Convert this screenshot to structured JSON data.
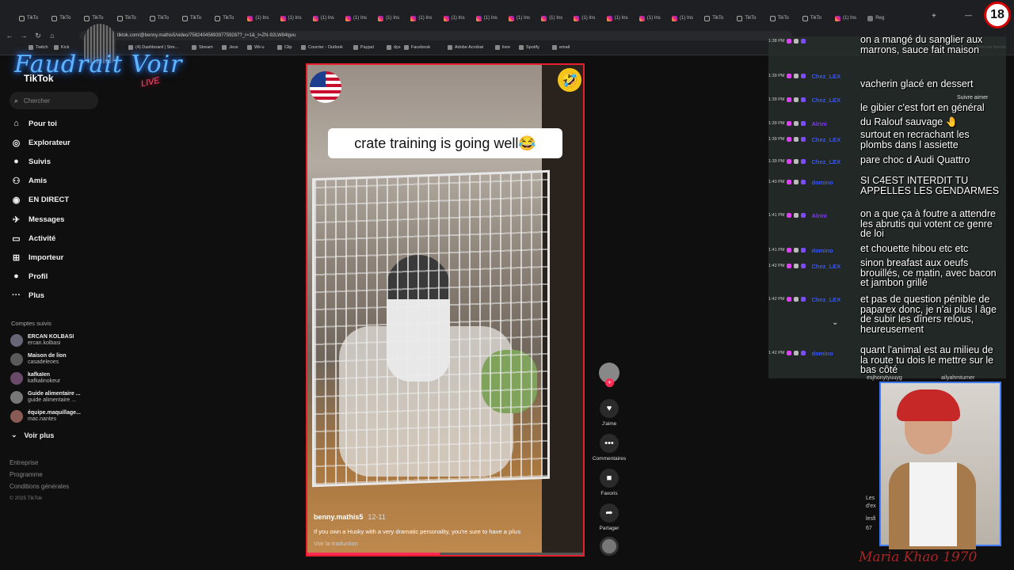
{
  "browser": {
    "tabs": [
      {
        "label": "TikTo",
        "icon": "tiktok-icon"
      },
      {
        "label": "TikTo",
        "icon": "tiktok-icon"
      },
      {
        "label": "TikTo",
        "icon": "tiktok-icon"
      },
      {
        "label": "TikTo",
        "icon": "tiktok-icon"
      },
      {
        "label": "TikTo",
        "icon": "tiktok-icon"
      },
      {
        "label": "TikTo",
        "icon": "tiktok-icon"
      },
      {
        "label": "TikTo",
        "icon": "tiktok-icon"
      },
      {
        "label": "(1) Ins",
        "icon": "instagram-icon"
      },
      {
        "label": "(1) Ins",
        "icon": "instagram-icon"
      },
      {
        "label": "(1) Ins",
        "icon": "instagram-icon"
      },
      {
        "label": "(1) Ins",
        "icon": "instagram-icon"
      },
      {
        "label": "(1) Ins",
        "icon": "instagram-icon"
      },
      {
        "label": "(1) Ins",
        "icon": "instagram-icon"
      },
      {
        "label": "(1) Ins",
        "icon": "instagram-icon"
      },
      {
        "label": "(1) Ins",
        "icon": "instagram-icon"
      },
      {
        "label": "(1) Ins",
        "icon": "instagram-icon"
      },
      {
        "label": "(1) Ins",
        "icon": "instagram-icon"
      },
      {
        "label": "(1) Ins",
        "icon": "instagram-icon"
      },
      {
        "label": "(1) Ins",
        "icon": "instagram-icon"
      },
      {
        "label": "(1) Ins",
        "icon": "instagram-icon"
      },
      {
        "label": "(1) Ins",
        "icon": "instagram-icon"
      },
      {
        "label": "TikTo",
        "icon": "tiktok-icon"
      },
      {
        "label": "TikTo",
        "icon": "tiktok-icon"
      },
      {
        "label": "TikTo",
        "icon": "tiktok-icon"
      },
      {
        "label": "TikTo",
        "icon": "tiktok-icon"
      },
      {
        "label": "(1) Ins",
        "icon": "instagram-icon"
      },
      {
        "label": "Reg",
        "icon": "page-icon"
      }
    ],
    "new_tab": "+",
    "url": "tiktok.com/@benny.mathis5/video/7582404569397759287?_r=1&_t=ZN-92LW84lgvu",
    "bookmarks": [
      "Twitch",
      "Kick",
      "(4) Dashboard | Stre...",
      "Stream",
      "Jeux",
      "Wii-u",
      "Clip",
      "Courrier - Outlook",
      "Paypal",
      "dys",
      "Facebook",
      "Adobe Acrobat",
      "livre",
      "Spotify",
      "email"
    ],
    "other_bookmarks": "Tous les favoris"
  },
  "overlay": {
    "logo_text": "Faudrait Voir",
    "logo_sub": "LIVE",
    "age_badge": "18",
    "signature": "Maria Khao 1970"
  },
  "sidebar": {
    "brand": "TikTok",
    "search_placeholder": "Chercher",
    "nav": [
      {
        "label": "Pour toi",
        "icon": "home-icon"
      },
      {
        "label": "Explorateur",
        "icon": "compass-icon"
      },
      {
        "label": "Suivis",
        "icon": "following-icon"
      },
      {
        "label": "Amis",
        "icon": "friends-icon"
      },
      {
        "label": "EN DIRECT",
        "icon": "live-icon"
      },
      {
        "label": "Messages",
        "icon": "message-icon"
      },
      {
        "label": "Activité",
        "icon": "activity-icon"
      },
      {
        "label": "Importeur",
        "icon": "upload-icon"
      },
      {
        "label": "Profil",
        "icon": "profile-icon"
      },
      {
        "label": "Plus",
        "icon": "more-icon"
      }
    ],
    "following_title": "Comptes suivis",
    "following": [
      {
        "name": "ERCAN KOLBASI",
        "handle": "ercan.kolbasi"
      },
      {
        "name": "Maison de lion",
        "handle": "casadeleoes"
      },
      {
        "name": "kafkaïen",
        "handle": "kafkalinokeur"
      },
      {
        "name": "Guide alimentaire ...",
        "handle": "guide alimentaire ..."
      },
      {
        "name": "équipe.maquillage...",
        "handle": "mac.nantes"
      }
    ],
    "see_more": "Voir plus",
    "footer": [
      "Entreprise",
      "Programme",
      "Conditions générales"
    ],
    "copyright": "© 2025 TikTok"
  },
  "video": {
    "caption": "crate training is going well😂",
    "badge_emoji": "🤣",
    "username": "benny.mathis5",
    "date": "12-11",
    "description": "If you own a Husky with a very dramatic personality, you're sure to have a",
    "more_label": "plus",
    "translate": "Voir la traduction",
    "progress": 0.48
  },
  "actions": {
    "follow_plus": "+",
    "items": [
      {
        "label": "J'aime",
        "icon": "heart-icon",
        "glyph": "♥"
      },
      {
        "label": "Commentaires",
        "icon": "comment-icon",
        "glyph": "•••"
      },
      {
        "label": "Favoris",
        "icon": "bookmark-icon",
        "glyph": "■"
      },
      {
        "label": "Partager",
        "icon": "share-icon",
        "glyph": "➦"
      }
    ]
  },
  "chat": {
    "rows": [
      {
        "time": "1:38 PM",
        "user": ""
      },
      {
        "time": "1:39 PM",
        "user": "Chez_LEX"
      },
      {
        "time": "1:39 PM",
        "user": "Chez_LEX"
      },
      {
        "time": "1:39 PM",
        "user": "Alrini"
      },
      {
        "time": "1:39 PM",
        "user": "Chez_LEX"
      },
      {
        "time": "1:39 PM",
        "user": "Chez_LEX"
      },
      {
        "time": "1:40 PM",
        "user": "domino"
      },
      {
        "time": "1:41 PM",
        "user": "Alrini"
      },
      {
        "time": "1:41 PM",
        "user": "domino"
      },
      {
        "time": "1:42 PM",
        "user": "Chez_LEX"
      },
      {
        "time": "1:42 PM",
        "user": "Chez_LEX"
      },
      {
        "time": "1:42 PM",
        "user": "domino"
      }
    ],
    "messages": [
      "on a mangé du sanglier aux marrons, sauce fait maison",
      "vacherin glacé en dessert",
      "le gibier c'est fort en général",
      "du Ralouf sauvage 🤚",
      "surtout en recrachant les plombs dans l assiette",
      "pare choc d Audi Quattro",
      "SI C4EST INTERDIT TU APPELLES LES GENDARMES",
      "on a que ça à foutre a attendre les abrutis qui votent ce genre de loi",
      "et chouette hibou etc etc",
      "sinon breafast aux oeufs brouillés, ce matin, avec bacon et jambon grillé",
      "et pas de question pénible de paparex donc, je n'ai plus l âge de subir les dîners relous, heureusement",
      "quant l'animal est au milieu de la route tu dois le mettre sur le bas côté"
    ]
  },
  "right_panel": {
    "suggest": "Suivre aimer",
    "cards": [
      "esjhonytyuuyg",
      "ailyahmturner"
    ],
    "side_bits": [
      "Les",
      "d'ex",
      "lesfi",
      "67"
    ]
  },
  "colors": {
    "accent": "#fe2c55",
    "frame": "#e8202e",
    "cam_border": "#3f7cff"
  }
}
